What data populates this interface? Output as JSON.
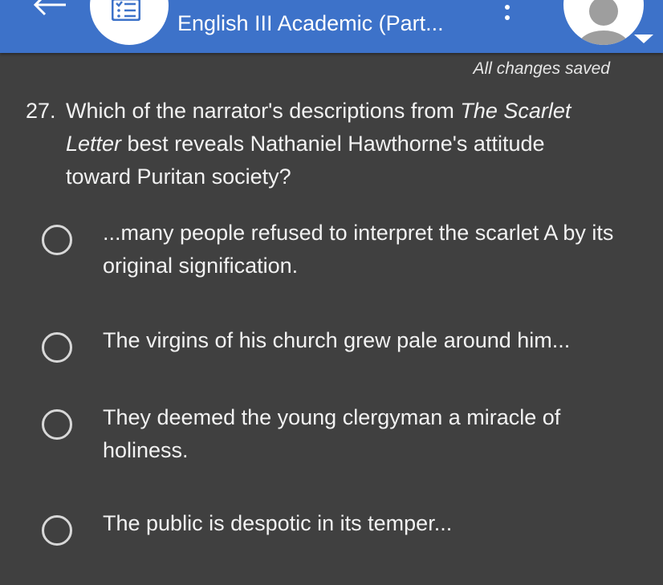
{
  "header": {
    "title": "English III Academic (Part...",
    "back_icon": "arrow-left-icon",
    "list_icon": "checklist-icon",
    "more_icon": "more-vert-icon",
    "avatar_icon": "user-avatar-icon",
    "dropdown_icon": "caret-down-icon",
    "bar_color": "#3d72c9"
  },
  "status": {
    "save_text": "All changes saved"
  },
  "question": {
    "number": "27.",
    "text_before": "Which of the narrator's descriptions from ",
    "book_title_part1": "The Scarlet",
    "book_title_part2": "Letter",
    "text_after_title": " best reveals Nathaniel Hawthorne's attitude",
    "text_last_line": "toward Puritan society?"
  },
  "options": [
    {
      "label": "...many people refused to interpret the scarlet A by its original signification.",
      "selected": false
    },
    {
      "label": "The virgins of his church grew pale around him...",
      "selected": false
    },
    {
      "label": "They deemed the young clergyman a miracle of holiness.",
      "selected": false
    },
    {
      "label": "The public is despotic in its temper...",
      "selected": false
    }
  ]
}
